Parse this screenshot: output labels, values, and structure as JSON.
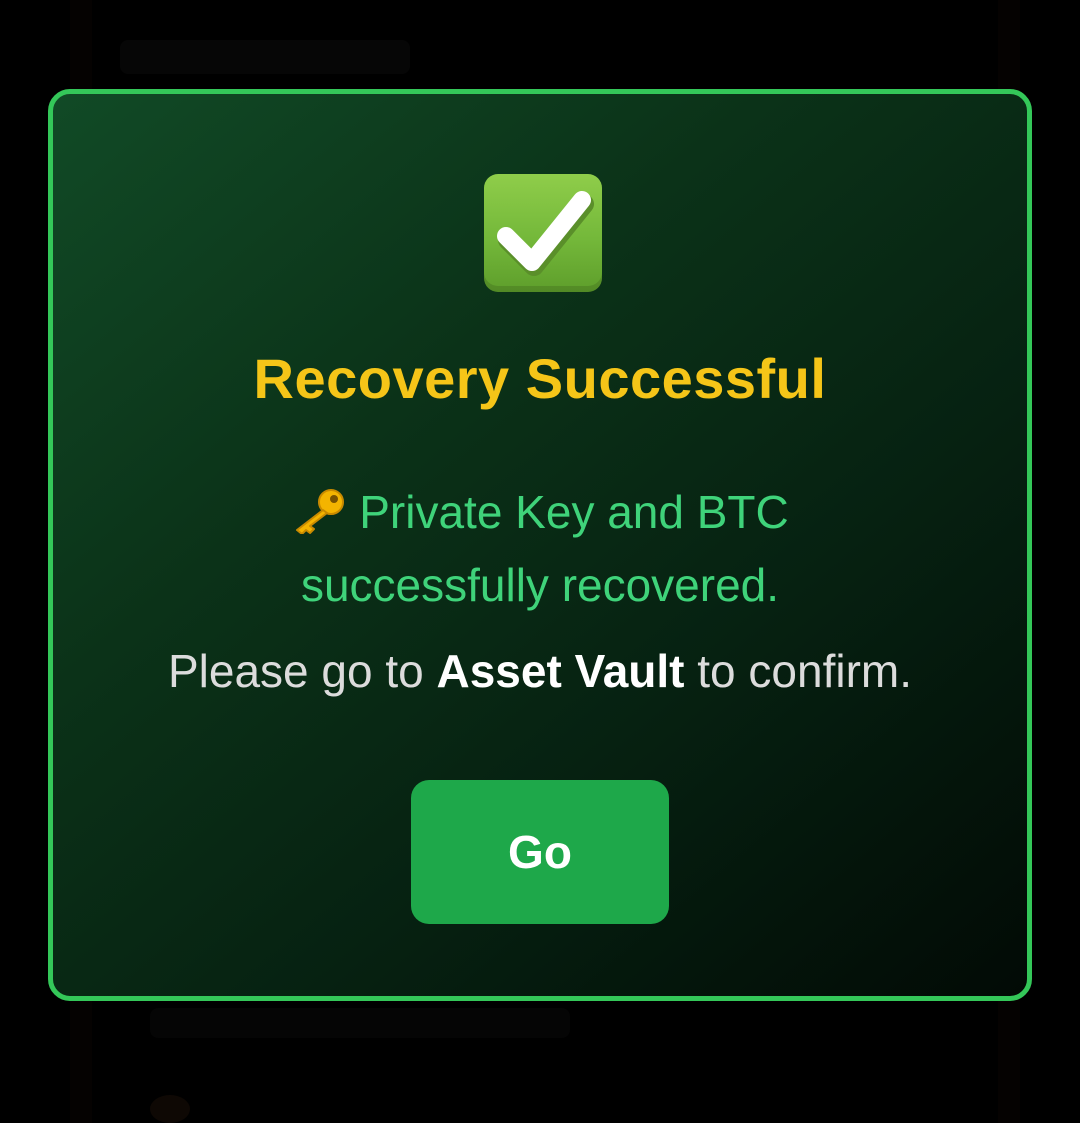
{
  "modal": {
    "icon": "check-mark-button-icon",
    "title": "Recovery Successful",
    "message_icon": "key-icon",
    "message_line1": "Private Key and BTC",
    "message_line2": "successfully recovered.",
    "confirm_prefix": "Please go to",
    "confirm_emphasis": "Asset Vault",
    "confirm_suffix": "to confirm.",
    "button_label": "Go"
  },
  "colors": {
    "border": "#34c759",
    "title": "#f5c518",
    "message": "#3fd37a",
    "button": "#1ea84a",
    "background": "#000000"
  }
}
